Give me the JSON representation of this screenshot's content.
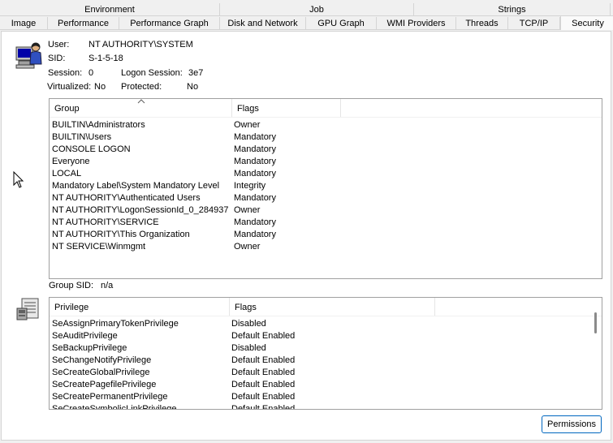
{
  "tabs_row1": [
    "Environment",
    "Job",
    "Strings"
  ],
  "tabs_row2": [
    "Image",
    "Performance",
    "Performance Graph",
    "Disk and Network",
    "GPU Graph",
    "WMI Providers",
    "Threads",
    "TCP/IP",
    "Security"
  ],
  "active_tab": "Security",
  "token": {
    "user_label": "User:",
    "user_value": "NT AUTHORITY\\SYSTEM",
    "sid_label": "SID:",
    "sid_value": "S-1-5-18",
    "session_label": "Session:",
    "session_value": "0",
    "logon_label": "Logon Session:",
    "logon_value": "3e7",
    "virtualized_label": "Virtualized:",
    "virtualized_value": "No",
    "protected_label": "Protected:",
    "protected_value": "No"
  },
  "groups": {
    "columns": [
      "Group",
      "Flags"
    ],
    "rows": [
      [
        "BUILTIN\\Administrators",
        "Owner"
      ],
      [
        "BUILTIN\\Users",
        "Mandatory"
      ],
      [
        "CONSOLE LOGON",
        "Mandatory"
      ],
      [
        "Everyone",
        "Mandatory"
      ],
      [
        "LOCAL",
        "Mandatory"
      ],
      [
        "Mandatory Label\\System Mandatory Level",
        "Integrity"
      ],
      [
        "NT AUTHORITY\\Authenticated Users",
        "Mandatory"
      ],
      [
        "NT AUTHORITY\\LogonSessionId_0_284937",
        "Owner"
      ],
      [
        "NT AUTHORITY\\SERVICE",
        "Mandatory"
      ],
      [
        "NT AUTHORITY\\This Organization",
        "Mandatory"
      ],
      [
        "NT SERVICE\\Winmgmt",
        "Owner"
      ]
    ],
    "group_sid_label": "Group SID:",
    "group_sid_value": "n/a"
  },
  "privileges": {
    "columns": [
      "Privilege",
      "Flags"
    ],
    "rows": [
      [
        "SeAssignPrimaryTokenPrivilege",
        "Disabled"
      ],
      [
        "SeAuditPrivilege",
        "Default Enabled"
      ],
      [
        "SeBackupPrivilege",
        "Disabled"
      ],
      [
        "SeChangeNotifyPrivilege",
        "Default Enabled"
      ],
      [
        "SeCreateGlobalPrivilege",
        "Default Enabled"
      ],
      [
        "SeCreatePagefilePrivilege",
        "Default Enabled"
      ],
      [
        "SeCreatePermanentPrivilege",
        "Default Enabled"
      ],
      [
        "SeCreateSymbolicLinkPrivilege",
        "Default Enabled"
      ]
    ]
  },
  "permissions_button": "Permissions"
}
